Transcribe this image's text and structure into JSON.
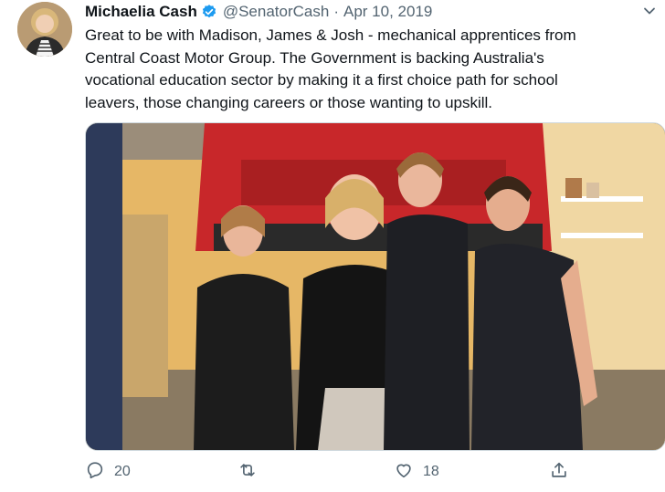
{
  "tweet": {
    "author_name": "Michaelia Cash",
    "handle": "@SenatorCash",
    "separator": "·",
    "date": "Apr 10, 2019",
    "text_lines": [
      "Great to be with Madison, James & Josh - mechanical apprentices from",
      "Central Coast Motor Group. The Government is backing Australia's",
      "vocational education sector by making it a first choice path for school",
      "leavers, those changing careers or those wanting to upskill."
    ]
  },
  "actions": {
    "reply_count": "20",
    "retweet_count": "",
    "like_count": "18"
  },
  "icons": {
    "verified": "verified-badge-icon",
    "more": "chevron-down-icon",
    "reply": "reply-icon",
    "retweet": "retweet-icon",
    "like": "heart-icon",
    "share": "share-icon"
  },
  "colors": {
    "verified_blue": "#1d9bf0",
    "text": "#0f1419",
    "secondary": "#536471"
  }
}
